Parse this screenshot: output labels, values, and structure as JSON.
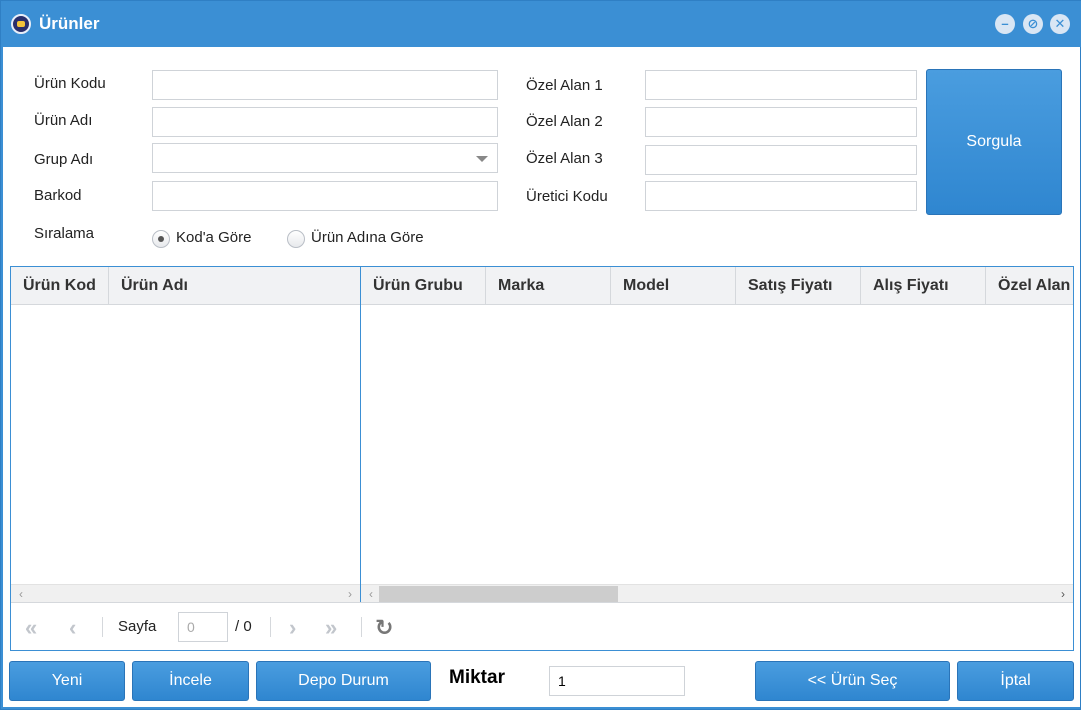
{
  "window": {
    "title": "Ürünler"
  },
  "form": {
    "urun_kodu": {
      "label": "Ürün Kodu",
      "value": ""
    },
    "urun_adi": {
      "label": "Ürün Adı",
      "value": ""
    },
    "grup_adi": {
      "label": "Grup Adı",
      "value": ""
    },
    "barkod": {
      "label": "Barkod",
      "value": ""
    },
    "ozel_alan_1": {
      "label": "Özel Alan 1",
      "value": ""
    },
    "ozel_alan_2": {
      "label": "Özel Alan 2",
      "value": ""
    },
    "ozel_alan_3": {
      "label": "Özel Alan 3",
      "value": ""
    },
    "uretici_kodu": {
      "label": "Üretici Kodu",
      "value": ""
    },
    "siralama": {
      "label": "Sıralama",
      "options": [
        "Kod'a Göre",
        "Ürün Adına Göre"
      ],
      "selected": "Kod'a Göre"
    },
    "search_button": "Sorgula"
  },
  "grid": {
    "left_columns": [
      "Ürün Kod",
      "Ürün Adı"
    ],
    "right_columns": [
      "Ürün Grubu",
      "Marka",
      "Model",
      "Satış Fiyatı",
      "Alış Fiyatı",
      "Özel Alan"
    ],
    "rows": []
  },
  "pager": {
    "page_label": "Sayfa",
    "page_value": "0",
    "page_total": "/ 0"
  },
  "footer": {
    "yeni": "Yeni",
    "incele": "İncele",
    "depo_durum": "Depo Durum",
    "miktar_label": "Miktar",
    "miktar_value": "1",
    "urun_sec": "<< Ürün Seç",
    "iptal": "İptal"
  },
  "icons": {
    "app": "app-icon",
    "minimize": "minimize-icon",
    "restore": "restore-icon",
    "close": "close-icon",
    "first": "first-page-icon",
    "prev": "prev-page-icon",
    "next": "next-page-icon",
    "last": "last-page-icon",
    "refresh": "refresh-icon"
  },
  "colors": {
    "accent": "#3b8fd4",
    "button": "#2f86d0"
  }
}
